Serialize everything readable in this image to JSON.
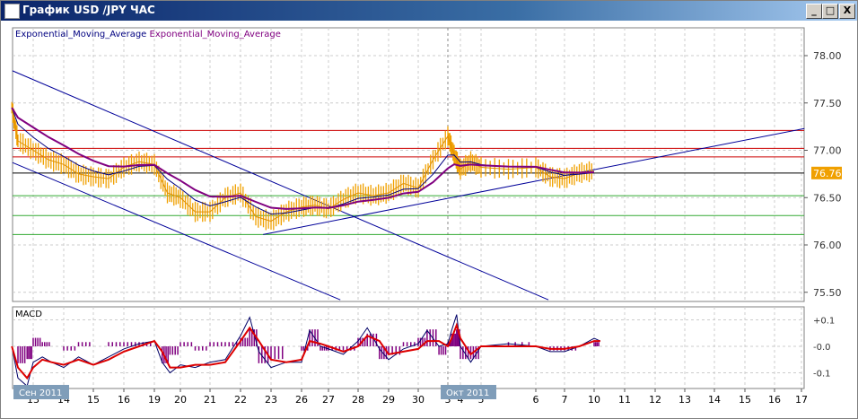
{
  "window": {
    "title": "График USD /JPY  ЧАС",
    "min_label": "_",
    "max_label": "□",
    "close_label": "X"
  },
  "legend": {
    "ema1": "Exponential_Moving_Average",
    "ema2": "Exponential_Moving_Average",
    "ema1_color": "#000080",
    "ema2_color": "#800080"
  },
  "macd_label": "MACD",
  "month_labels": {
    "sep": "Сен 2011",
    "oct": "Окт 2011"
  },
  "current_price": "76.76",
  "chart_data": {
    "type": "line",
    "title": "USD/JPY hourly",
    "x_ticks": [
      "13",
      "14",
      "15",
      "16",
      "19",
      "20",
      "21",
      "22",
      "23",
      "26",
      "27",
      "28",
      "29",
      "30",
      "3",
      "4",
      "5",
      "6",
      "7",
      "10",
      "11",
      "12",
      "13",
      "14",
      "15",
      "16",
      "17"
    ],
    "price_ticks": [
      "78.00",
      "77.50",
      "77.00",
      "76.50",
      "76.00",
      "75.50"
    ],
    "price_tick_values": [
      78.0,
      77.5,
      77.0,
      76.5,
      76.0,
      75.5
    ],
    "ylim": [
      75.4,
      78.3
    ],
    "macd_ticks": [
      "+0.1",
      "-0.0",
      "-0.1"
    ],
    "macd_tick_values": [
      0.1,
      0,
      -0.1
    ],
    "macd_ylim": [
      -0.16,
      0.14
    ],
    "price": {
      "t": [
        -0.7,
        -0.5,
        0,
        0.5,
        1,
        1.5,
        2,
        2.5,
        3,
        3.5,
        4,
        4.5,
        5,
        5.5,
        6,
        6.5,
        7,
        7.5,
        8,
        8.5,
        9,
        9.5,
        10,
        10.5,
        11,
        11.5,
        12,
        12.5,
        13,
        13.5,
        14,
        14.5,
        15,
        15.5,
        16,
        16.5,
        17,
        17.5,
        18,
        18.5,
        19
      ],
      "close": [
        77.45,
        77.1,
        77.0,
        76.9,
        76.85,
        76.75,
        76.72,
        76.7,
        76.82,
        76.88,
        76.85,
        76.55,
        76.5,
        76.35,
        76.35,
        76.5,
        76.55,
        76.3,
        76.25,
        76.35,
        76.4,
        76.42,
        76.38,
        76.48,
        76.55,
        76.52,
        76.55,
        76.65,
        76.6,
        76.9,
        77.15,
        76.95,
        76.8,
        76.88,
        76.82,
        76.8,
        76.82,
        76.72,
        76.7,
        76.76,
        76.78
      ]
    },
    "horizontal_lines": [
      {
        "price": 77.21,
        "color": "#cc0000"
      },
      {
        "price": 77.02,
        "color": "#cc0000"
      },
      {
        "price": 76.93,
        "color": "#cc0000"
      },
      {
        "price": 76.76,
        "color": "#000000"
      },
      {
        "price": 76.52,
        "color": "#33aa33"
      },
      {
        "price": 76.31,
        "color": "#33aa33"
      },
      {
        "price": 76.11,
        "color": "#33aa33"
      }
    ],
    "trend_lines": [
      {
        "t1": -0.68,
        "p1": 77.84,
        "t2": 17.44,
        "p2": 75.42
      },
      {
        "t1": -0.68,
        "p1": 76.87,
        "t2": 10.4,
        "p2": 75.42
      },
      {
        "t1": 7.74,
        "p1": 76.11,
        "t2": 26.1,
        "p2": 77.23
      }
    ],
    "macd": {
      "t": [
        -0.7,
        -0.5,
        -0.2,
        0,
        0.3,
        0.6,
        1,
        1.5,
        2,
        2.5,
        3,
        3.5,
        4,
        4.3,
        4.6,
        5,
        5.5,
        6,
        6.5,
        7,
        7.3,
        7.6,
        8,
        8.5,
        9,
        9.3,
        9.7,
        10,
        10.5,
        11,
        11.3,
        11.7,
        12,
        12.5,
        13,
        13.3,
        13.7,
        14,
        14.3,
        14.7,
        15,
        15.5,
        16,
        16.5,
        17,
        17.5,
        18,
        18.5,
        19,
        19.2
      ],
      "signal": [
        0.0,
        -0.08,
        -0.12,
        -0.08,
        -0.05,
        -0.06,
        -0.07,
        -0.05,
        -0.07,
        -0.05,
        -0.02,
        0.0,
        0.02,
        -0.02,
        -0.08,
        -0.08,
        -0.07,
        -0.07,
        -0.06,
        0.02,
        0.07,
        0.02,
        -0.05,
        -0.06,
        -0.05,
        0.02,
        0.01,
        0.0,
        -0.02,
        0.0,
        0.04,
        0.02,
        -0.03,
        -0.02,
        -0.01,
        0.02,
        0.02,
        0.0,
        0.03,
        0.08,
        0.03,
        -0.03,
        0.0,
        0.0,
        0.0,
        -0.01,
        -0.01,
        0.0,
        0.02,
        0.02
      ],
      "macd": [
        0.0,
        -0.12,
        -0.15,
        -0.06,
        -0.04,
        -0.06,
        -0.08,
        -0.04,
        -0.07,
        -0.04,
        -0.01,
        0.01,
        0.02,
        -0.06,
        -0.1,
        -0.07,
        -0.08,
        -0.06,
        -0.05,
        0.04,
        0.11,
        -0.02,
        -0.08,
        -0.06,
        -0.06,
        0.06,
        0.0,
        -0.01,
        -0.03,
        0.02,
        0.07,
        -0.01,
        -0.05,
        -0.01,
        0.01,
        0.06,
        0.0,
        0.01,
        0.06,
        0.12,
        0.0,
        -0.06,
        0.0,
        0.01,
        0.0,
        -0.02,
        -0.02,
        0.0,
        0.03,
        0.02
      ]
    }
  }
}
